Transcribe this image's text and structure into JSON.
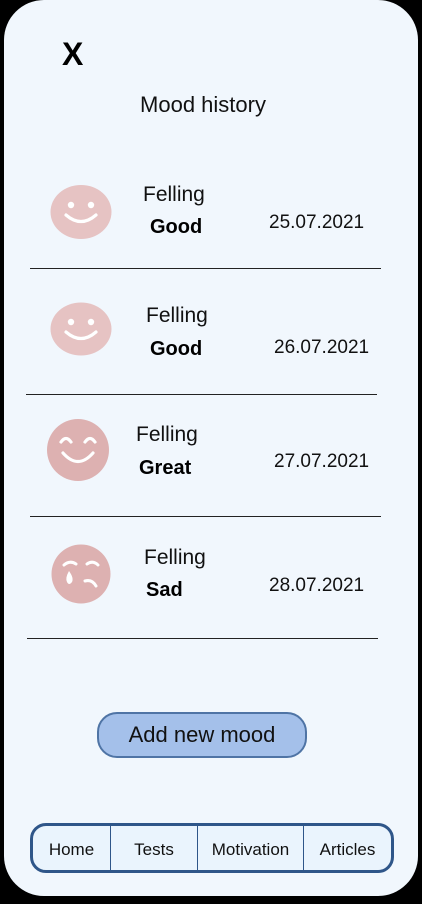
{
  "header": {
    "close_label": "X",
    "title": "Mood history"
  },
  "entries": [
    {
      "felling_label": "Felling",
      "mood": "Good",
      "date": "25.07.2021",
      "face_icon": "smile-face-icon"
    },
    {
      "felling_label": "Felling",
      "mood": "Good",
      "date": "26.07.2021",
      "face_icon": "smile-face-icon"
    },
    {
      "felling_label": "Felling",
      "mood": "Great",
      "date": "27.07.2021",
      "face_icon": "laughing-face-icon"
    },
    {
      "felling_label": "Felling",
      "mood": "Sad",
      "date": "28.07.2021",
      "face_icon": "crying-face-icon"
    }
  ],
  "actions": {
    "add_mood_label": "Add new mood"
  },
  "nav": {
    "items": [
      {
        "label": "Home"
      },
      {
        "label": "Tests"
      },
      {
        "label": "Motivation"
      },
      {
        "label": "Articles"
      }
    ]
  },
  "colors": {
    "background": "#f1f7fd",
    "face_light": "#e6c3c3",
    "face_dark": "#ddb1b1",
    "button_fill": "#a4c0ea",
    "button_border": "#4f74a5",
    "nav_border": "#2f5689"
  }
}
